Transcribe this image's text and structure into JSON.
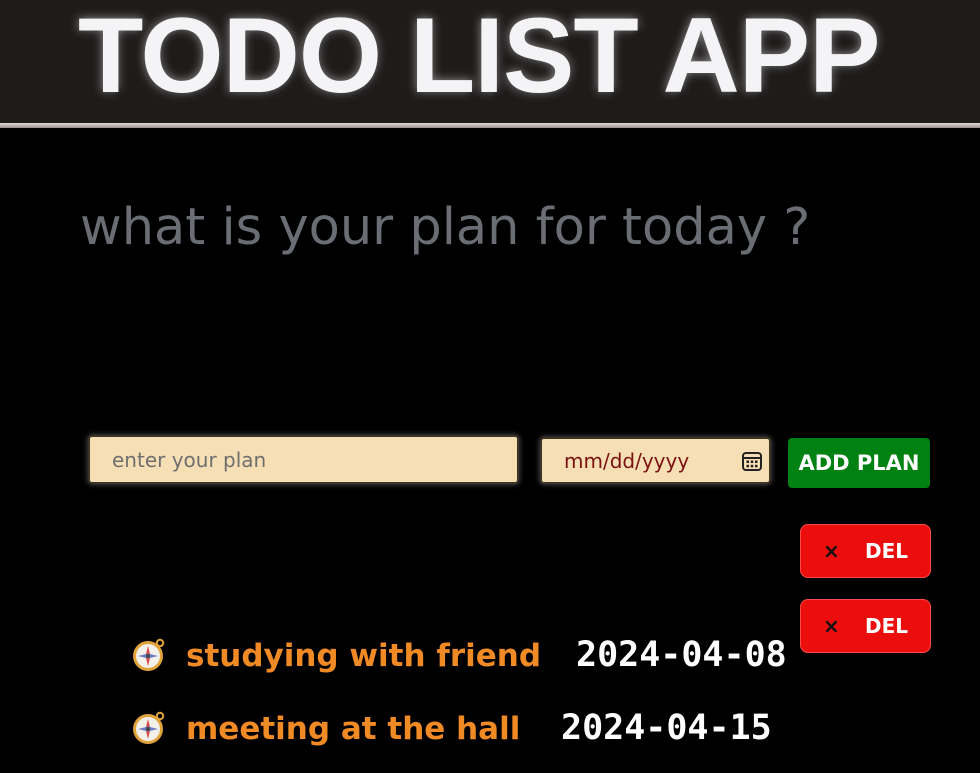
{
  "header": {
    "title": "TODO LIST APP"
  },
  "main": {
    "prompt": "what is your plan for today ?"
  },
  "form": {
    "plan_placeholder": "enter your plan",
    "plan_value": "",
    "date_placeholder": "mm/dd/yyyy",
    "calendar_icon": "calendar-icon",
    "add_label": "ADD PLAN",
    "add_color": "#008212"
  },
  "todos": [
    {
      "icon": "compass-icon",
      "text": "studying with friend",
      "date": "2024-04-08",
      "delete_icon": "×",
      "delete_label": "DEL"
    },
    {
      "icon": "compass-icon",
      "text": "meeting at the hall",
      "date": "2024-04-15",
      "delete_icon": "×",
      "delete_label": "DEL"
    }
  ],
  "colors": {
    "background": "#000000",
    "header_bar": "#1f1b1a",
    "input_bg": "#f6dfb4",
    "todo_text": "#f08a24",
    "delete_button": "#ec0d0d"
  }
}
